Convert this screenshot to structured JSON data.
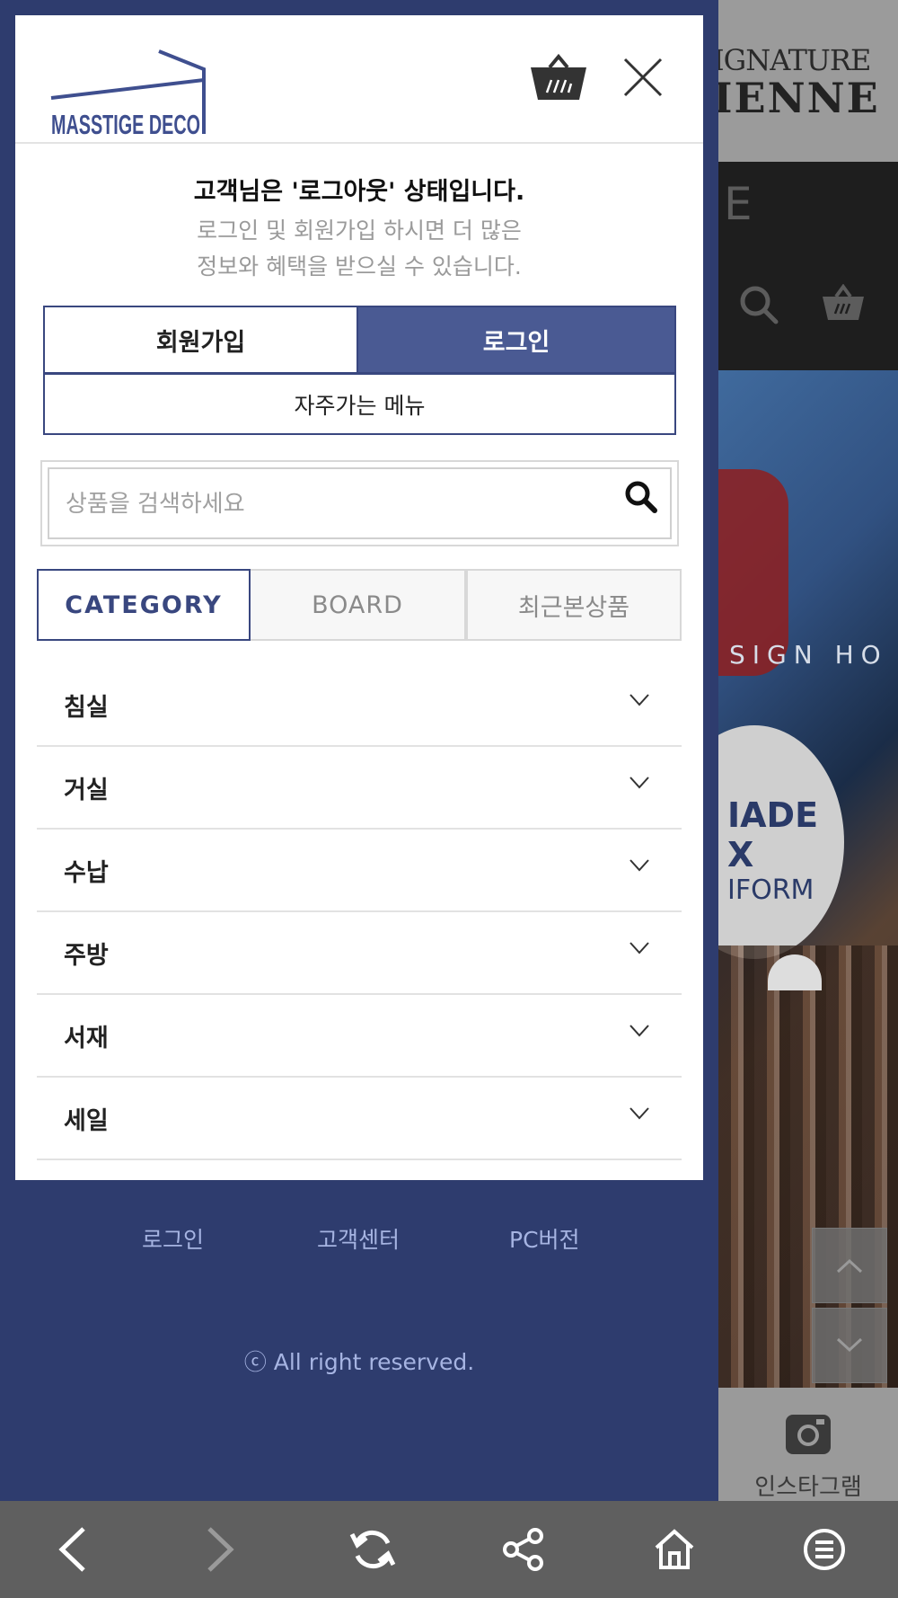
{
  "background_page": {
    "logo_line1": "IGNATURE",
    "logo_line2": "IENNE",
    "nav_partial": "E",
    "sign_text": "SIGN HO",
    "circle_text": [
      "IADE",
      "X",
      "IFORM"
    ],
    "instagram_label": "인스타그램"
  },
  "drawer": {
    "brand": {
      "name": "MASSTIGE DECO",
      "color": "#3f4f8f"
    },
    "status_title": "고객님은 '로그아웃' 상태입니다.",
    "status_desc_line1": "로그인 및 회원가입 하시면 더 많은",
    "status_desc_line2": "정보와 혜택을 받으실 수 있습니다.",
    "signup_label": "회원가입",
    "login_label": "로그인",
    "favorite_menu_label": "자주가는 메뉴",
    "search": {
      "placeholder": "상품을 검색하세요",
      "value": ""
    },
    "tabs": [
      {
        "label": "CATEGORY",
        "active": true
      },
      {
        "label": "BOARD",
        "active": false
      },
      {
        "label": "최근본상품",
        "active": false
      }
    ],
    "categories": [
      {
        "label": "침실"
      },
      {
        "label": "거실"
      },
      {
        "label": "수납"
      },
      {
        "label": "주방"
      },
      {
        "label": "서재"
      },
      {
        "label": "세일"
      }
    ]
  },
  "footer": {
    "links": [
      "로그인",
      "고객센터",
      "PC버전"
    ],
    "copyright": "ⓒ All right reserved."
  },
  "colors": {
    "primary": "#39477f",
    "primary_fill": "#4a5a93",
    "footer_bg": "#2e3c6e",
    "footer_text": "#a6b4e2",
    "toolbar_bg": "#5f5f5f"
  }
}
